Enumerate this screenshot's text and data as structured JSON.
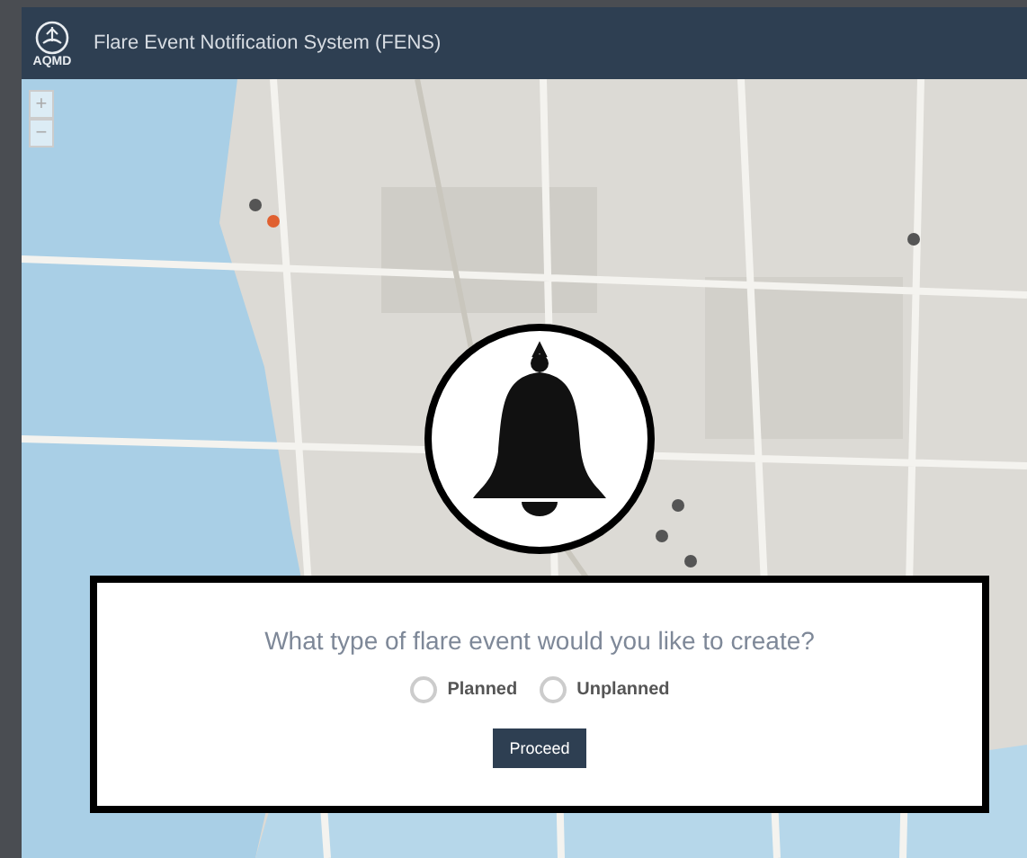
{
  "header": {
    "logo_text": "AQMD",
    "title": "Flare Event Notification System (FENS)"
  },
  "map": {
    "kind": "picture",
    "zoom_controls": [
      "+",
      "−"
    ]
  },
  "dialog": {
    "question": "What type of flare event would you like to create?",
    "options": [
      {
        "label": "Planned",
        "selected": false
      },
      {
        "label": "Unplanned",
        "selected": false
      }
    ],
    "button": "Proceed"
  }
}
